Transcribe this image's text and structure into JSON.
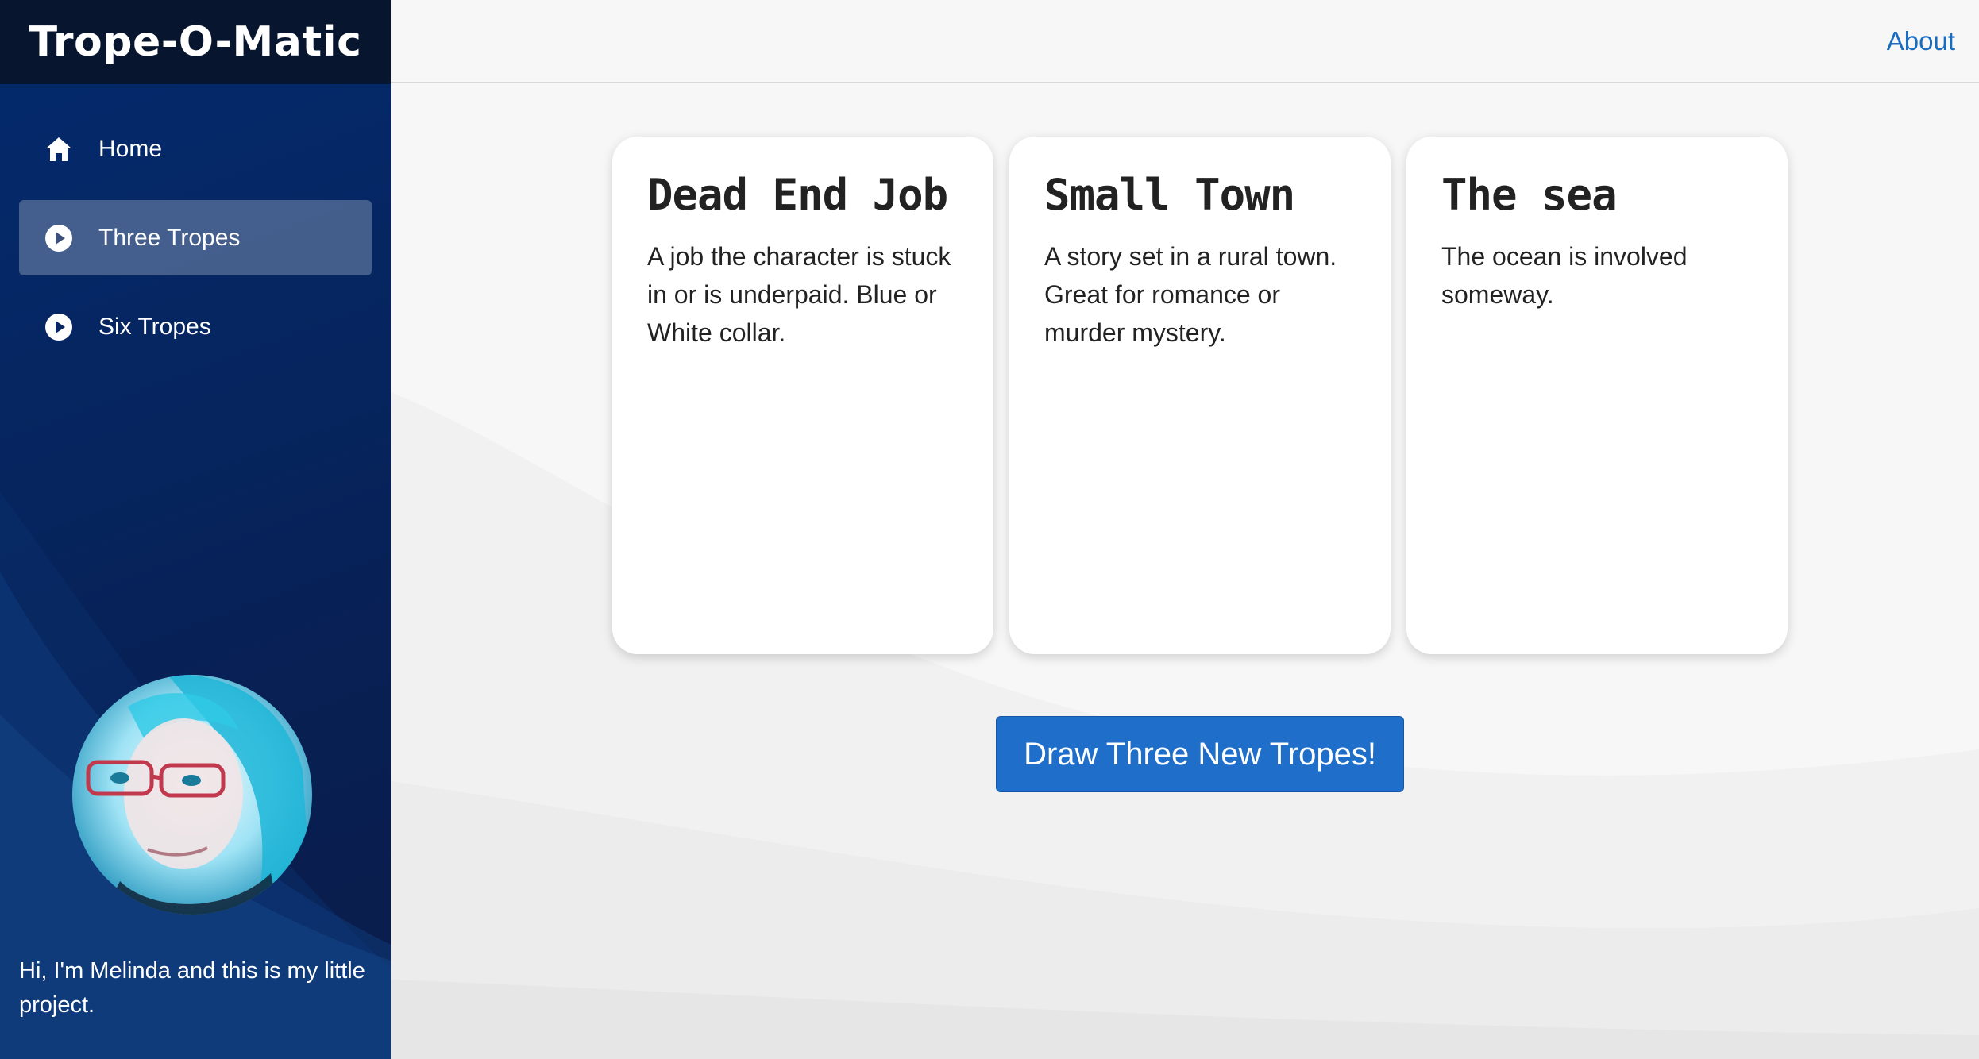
{
  "app": {
    "title": "Trope-O-Matic"
  },
  "sidebar": {
    "items": [
      {
        "label": "Home",
        "icon": "home-icon",
        "active": false
      },
      {
        "label": "Three Tropes",
        "icon": "play-circle-icon",
        "active": true
      },
      {
        "label": "Six Tropes",
        "icon": "play-circle-icon",
        "active": false
      }
    ],
    "bio": "Hi, I'm Melinda and this is my little project."
  },
  "topbar": {
    "about_label": "About"
  },
  "cards": [
    {
      "title": "Dead End Job",
      "text": "A job the character is stuck in or is underpaid. Blue or White collar."
    },
    {
      "title": "Small Town",
      "text": "A story set in a rural town. Great for romance or murder mystery."
    },
    {
      "title": "The sea",
      "text": "The ocean is involved someway."
    }
  ],
  "actions": {
    "draw_label": "Draw Three New Tropes!"
  },
  "colors": {
    "sidebar_bg": "#06255f",
    "brand_bg": "#07152f",
    "primary_button": "#1f6fca",
    "link": "#1a6cbf",
    "main_bg": "#f7f7f7"
  }
}
